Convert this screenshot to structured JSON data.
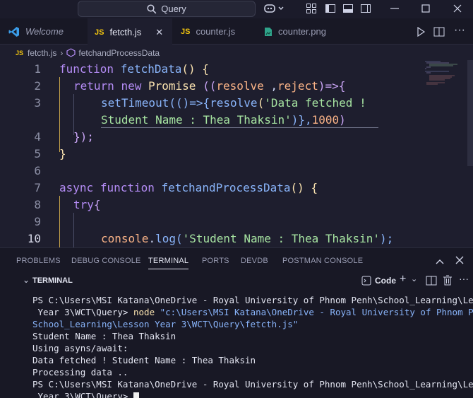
{
  "titlebar": {
    "search_label": "Query"
  },
  "tabs": [
    {
      "label": "Welcome",
      "icon": "vscode-logo-icon"
    },
    {
      "label": "fetcth.js",
      "icon": "js-file-icon",
      "active": true
    },
    {
      "label": "counter.js",
      "icon": "js-file-icon"
    },
    {
      "label": "counter.png",
      "icon": "image-file-icon"
    }
  ],
  "breadcrumb": {
    "file": "fetcth.js",
    "symbol": "fetchandProcessData"
  },
  "editor": {
    "line_numbers": [
      "1",
      "2",
      "3",
      "",
      "4",
      "5",
      "6",
      "7",
      "8",
      "9",
      "10"
    ],
    "code": {
      "l1_kw": "function",
      "l1_fn": "fetchData",
      "l1_rest": "() {",
      "l2_kw": "return",
      "l2_new": "new",
      "l2_cls": "Promise",
      "l2_p1": "((",
      "l2_a": "resolve",
      "l2_b": " ,",
      "l2_c": "reject",
      "l2_d": ")=>{",
      "l3_fn": "setTimeout",
      "l3_a": "(()=>{",
      "l3_b": "resolve",
      "l3_c": "(",
      "l3_str": "'Data fetched !",
      "l3b_str": "Student Name : Thea Thaksin'",
      "l3b_rest": ")},",
      "l3b_num": "1000",
      "l3b_end": ")",
      "l4": "});",
      "l5": "}",
      "l7_kw1": "async",
      "l7_kw2": "function",
      "l7_fn": "fetchandProcessData",
      "l7_rest": "() {",
      "l8_kw": "try",
      "l8_b": "{",
      "l10_obj": "console",
      "l10_dot": ".",
      "l10_fn": "log",
      "l10_a": "(",
      "l10_str": "'Student Name : Thea Thaksin'",
      "l10_end": ");"
    }
  },
  "panel": {
    "tabs": [
      "PROBLEMS",
      "DEBUG CONSOLE",
      "TERMINAL",
      "PORTS",
      "DEVDB",
      "POSTMAN CONSOLE"
    ],
    "active_tab": "TERMINAL",
    "terminal_label": "TERMINAL",
    "shell_label": "Code"
  },
  "terminal": {
    "line1": "PS C:\\Users\\MSI Katana\\OneDrive - Royal University of Phnom Penh\\School_Learning\\Lesson",
    "line2_prompt": " Year 3\\WCT\\Query> ",
    "line2_cmd": "node",
    "line2_arg": " \"c:\\Users\\MSI Katana\\OneDrive - Royal University of Phnom Penh\\",
    "line3_arg": "School_Learning\\Lesson Year 3\\WCT\\Query\\fetcth.js\"",
    "out1": "Student Name : Thea Thaksin",
    "out2": "Using asyns/await:",
    "out3": "Data fetched ! Student Name : Thea Thaksin",
    "out4": "Processing data ..",
    "line4": "PS C:\\Users\\MSI Katana\\OneDrive - Royal University of Phnom Penh\\School_Learning\\Lesson",
    "line5_prompt": " Year 3\\WCT\\Query> "
  },
  "colors": {
    "keyword": "#b48cf5",
    "function": "#89b4fa",
    "string": "#a6e3a1",
    "number": "#fab387",
    "background": "#1e1e2e"
  }
}
